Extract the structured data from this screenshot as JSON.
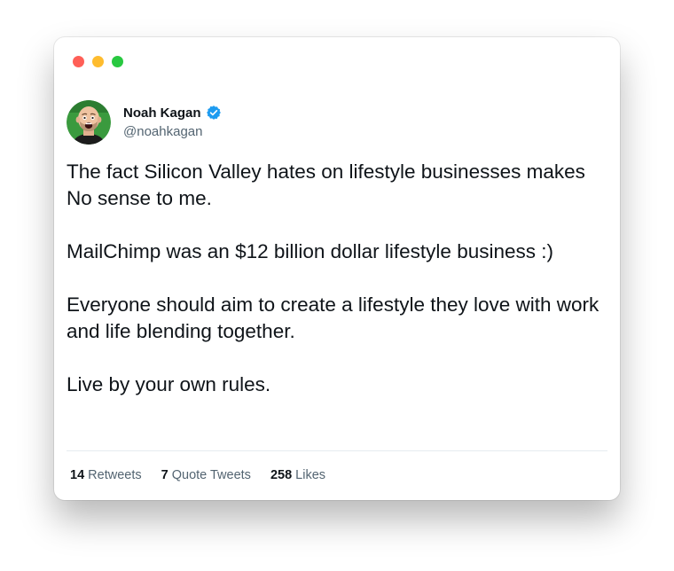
{
  "window": {
    "traffic_lights": [
      "close",
      "minimize",
      "maximize"
    ],
    "colors": {
      "close": "#ff5f57",
      "minimize": "#febc2e",
      "maximize": "#28c840"
    }
  },
  "tweet": {
    "author": {
      "name": "Noah Kagan",
      "handle": "@noahkagan",
      "verified": true,
      "avatar_icon": "profile-photo"
    },
    "paragraphs": [
      "The fact Silicon Valley hates on lifestyle businesses makes No sense to me.",
      "MailChimp was an $12 billion dollar lifestyle business :)",
      "Everyone should aim to create a lifestyle they love with work and life blending together.",
      "Live by your own rules."
    ],
    "stats": {
      "retweets_count": "14",
      "retweets_label": "Retweets",
      "quote_tweets_count": "7",
      "quote_tweets_label": "Quote Tweets",
      "likes_count": "258",
      "likes_label": "Likes"
    },
    "colors": {
      "verified_badge": "#1d9bf0",
      "text": "#0f1419",
      "secondary_text": "#536471"
    }
  }
}
